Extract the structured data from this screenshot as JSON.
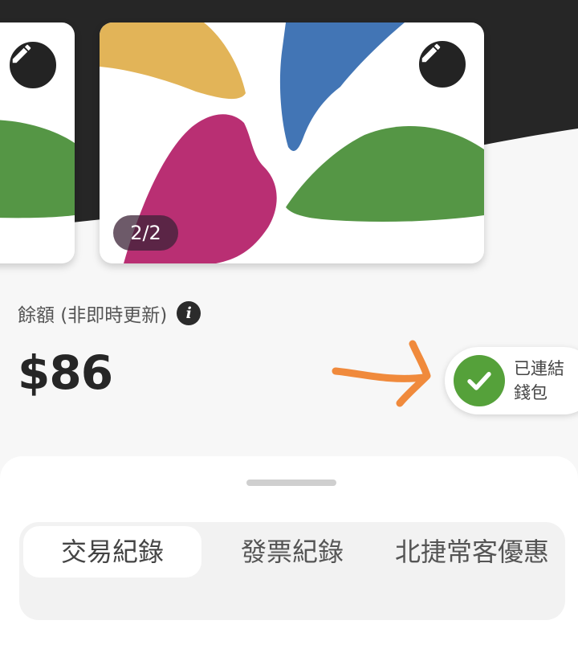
{
  "card": {
    "counter": "2/2",
    "colors": {
      "yellow": "#e2b458",
      "blue": "#4275b5",
      "magenta": "#b92f73",
      "green": "#559645"
    }
  },
  "balance": {
    "label": "餘額 (非即時更新)",
    "info_icon": "info-icon",
    "amount": "$86"
  },
  "wallet": {
    "status": "已連結錢包",
    "status_color": "#55a13a",
    "annotation_color": "#f08a3c"
  },
  "tabs": [
    {
      "label": "交易紀錄",
      "active": true
    },
    {
      "label": "發票紀錄",
      "active": false
    },
    {
      "label": "北捷常客優惠",
      "active": false
    }
  ]
}
